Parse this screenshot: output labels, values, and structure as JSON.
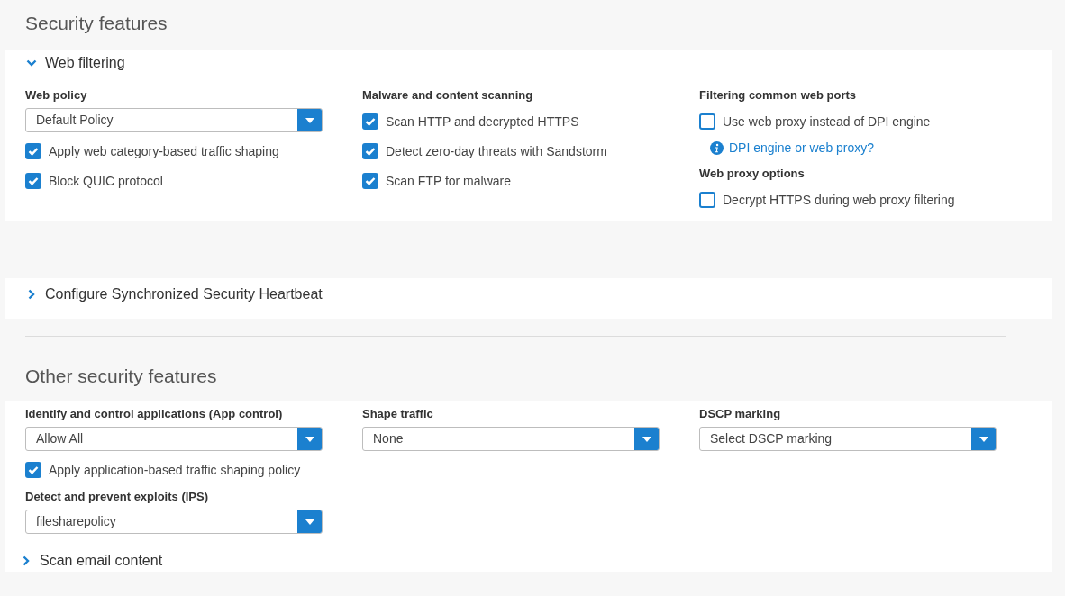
{
  "sections": [
    {
      "title": "Security features",
      "blocks": [
        {
          "kind": "collapsible",
          "title": "Web filtering",
          "expanded": true,
          "columns": [
            [
              {
                "kind": "label",
                "text": "Web policy"
              },
              {
                "kind": "select",
                "value": "Default Policy"
              },
              {
                "kind": "checkbox",
                "label": "Apply web category-based traffic shaping",
                "checked": true
              },
              {
                "kind": "checkbox",
                "label": "Block QUIC protocol",
                "checked": true
              }
            ],
            [
              {
                "kind": "label",
                "text": "Malware and content scanning"
              },
              {
                "kind": "checkbox",
                "label": "Scan HTTP and decrypted HTTPS",
                "checked": true
              },
              {
                "kind": "checkbox",
                "label": "Detect zero-day threats with Sandstorm",
                "checked": true
              },
              {
                "kind": "checkbox",
                "label": "Scan FTP for malware",
                "checked": true
              }
            ],
            [
              {
                "kind": "label",
                "text": "Filtering common web ports"
              },
              {
                "kind": "checkbox",
                "label": "Use web proxy instead of DPI engine",
                "checked": false
              },
              {
                "kind": "link",
                "text": "DPI engine or web proxy?"
              },
              {
                "kind": "label",
                "text": "Web proxy options"
              },
              {
                "kind": "checkbox",
                "label": "Decrypt HTTPS during web proxy filtering",
                "checked": false
              }
            ]
          ]
        },
        {
          "kind": "collapsible",
          "title": "Configure Synchronized Security Heartbeat",
          "expanded": false
        }
      ]
    },
    {
      "title": "Other security features",
      "blocks": [
        {
          "kind": "plain",
          "columns": [
            [
              {
                "kind": "label",
                "text": "Identify and control applications (App control)"
              },
              {
                "kind": "select",
                "value": "Allow All"
              },
              {
                "kind": "checkbox",
                "label": "Apply application-based traffic shaping policy",
                "checked": true
              },
              {
                "kind": "label",
                "text": "Detect and prevent exploits (IPS)"
              },
              {
                "kind": "select",
                "value": "filesharepolicy"
              }
            ],
            [
              {
                "kind": "label",
                "text": "Shape traffic"
              },
              {
                "kind": "select",
                "value": "None"
              }
            ],
            [
              {
                "kind": "label",
                "text": "DSCP marking"
              },
              {
                "kind": "select",
                "value": "Select DSCP marking"
              }
            ]
          ],
          "collapsibles": [
            {
              "title": "Scan email content",
              "expanded": false
            }
          ]
        }
      ]
    }
  ]
}
